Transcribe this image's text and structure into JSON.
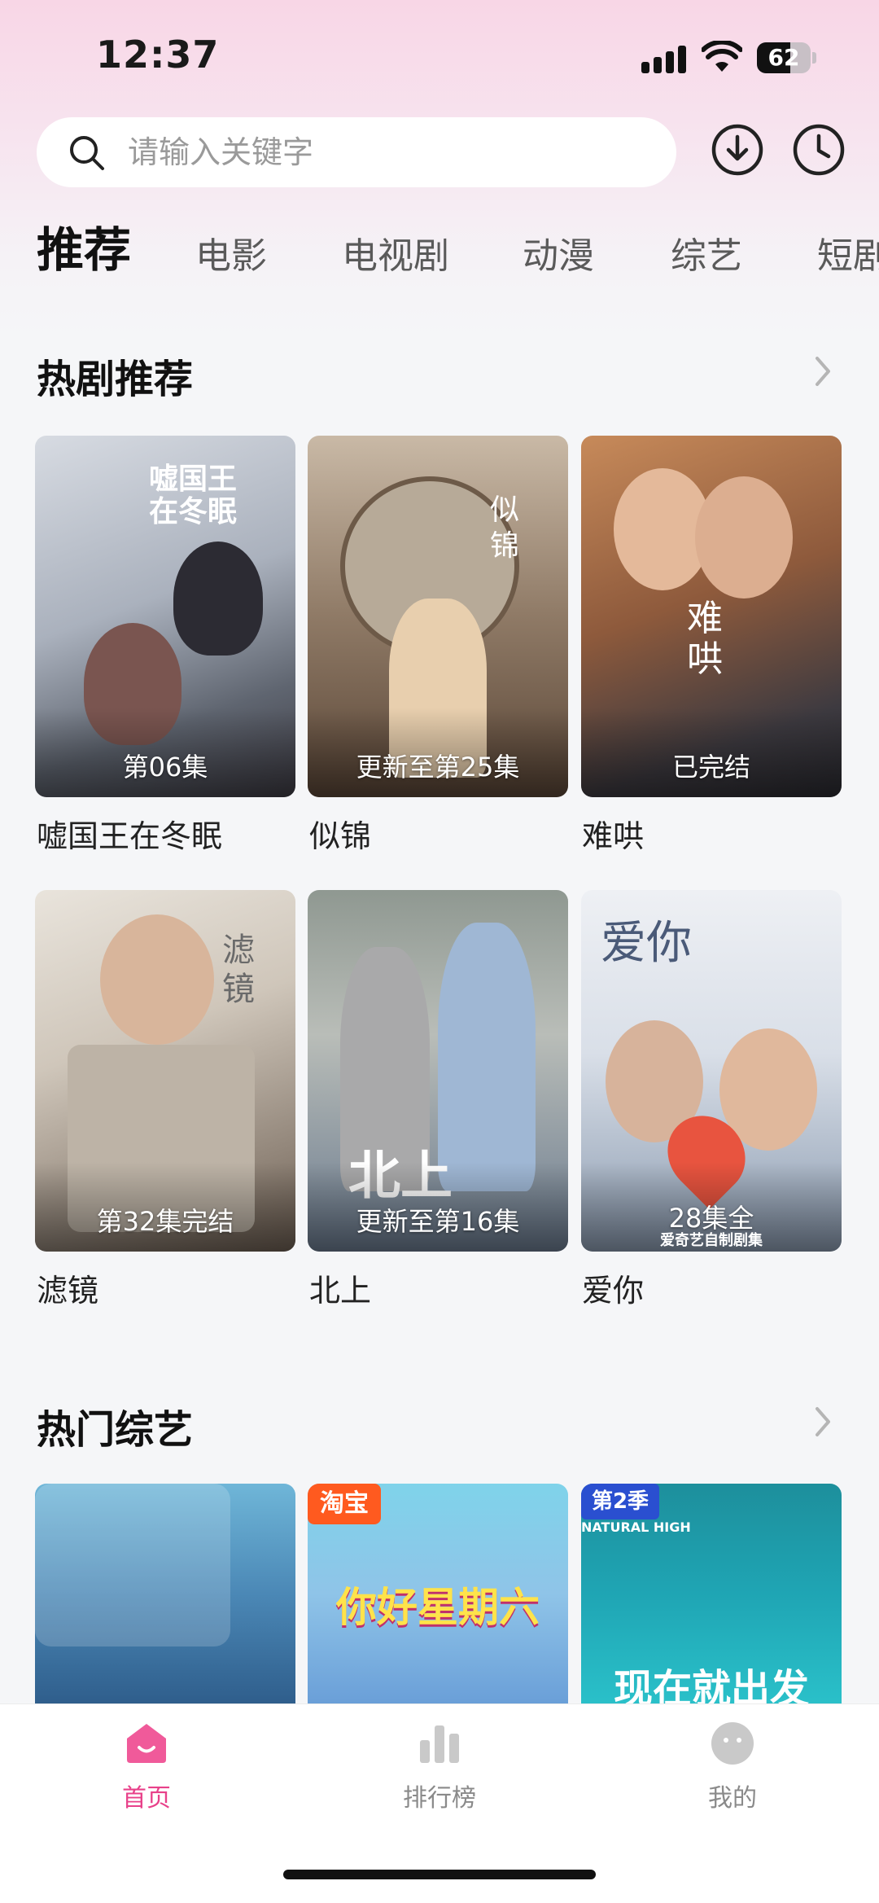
{
  "status_bar": {
    "time": "12:37",
    "battery": "62",
    "battery_level": 0.62
  },
  "search": {
    "placeholder": "请输入关键字"
  },
  "tabs": [
    {
      "label": "推荐",
      "active": true
    },
    {
      "label": "电影",
      "active": false
    },
    {
      "label": "电视剧",
      "active": false
    },
    {
      "label": "动漫",
      "active": false
    },
    {
      "label": "综艺",
      "active": false
    },
    {
      "label": "短剧",
      "active": false
    }
  ],
  "hot_drama": {
    "title": "热剧推荐",
    "items": [
      {
        "name": "嘘国王在冬眠",
        "badge": "第06集",
        "poster_text": "嘘国王在冬眠"
      },
      {
        "name": "似锦",
        "badge": "更新至第25集",
        "poster_text": "似锦"
      },
      {
        "name": "难哄",
        "badge": "已完结",
        "poster_text": "难哄"
      },
      {
        "name": "滤镜",
        "badge": "第32集完结",
        "poster_text": "滤镜"
      },
      {
        "name": "北上",
        "badge": "更新至第16集",
        "poster_text": "北上"
      },
      {
        "name": "爱你",
        "badge": "28集全",
        "poster_text": "爱你",
        "poster_subtext": "爱奇艺自制剧集"
      }
    ]
  },
  "hot_variety": {
    "title": "热门综艺",
    "items": [
      {
        "poster_text": ""
      },
      {
        "poster_text": "你好星期六",
        "poster_badge": "淘宝"
      },
      {
        "poster_text": "现在就出发",
        "poster_badge": "第2季",
        "poster_subtext": "NATURAL HIGH"
      }
    ]
  },
  "bottom_nav": [
    {
      "label": "首页",
      "icon": "home-icon",
      "active": true
    },
    {
      "label": "排行榜",
      "icon": "ranking-icon",
      "active": false
    },
    {
      "label": "我的",
      "icon": "profile-icon",
      "active": false
    }
  ],
  "colors": {
    "accent": "#e8418a",
    "background": "#f5f6f8",
    "header_gradient_top": "#f8d6e6"
  }
}
